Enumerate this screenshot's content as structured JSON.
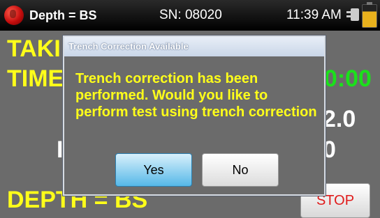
{
  "status_bar": {
    "mode": "Depth = BS",
    "serial": "SN: 08020",
    "time": "11:39 AM",
    "icons": [
      "globe-icon",
      "power-plug-icon",
      "battery-icon"
    ]
  },
  "background_screen": {
    "label_taking": "TAKI",
    "label_time": "TIME",
    "timer_partial": "00:00",
    "value_partial_1": "2.0",
    "value_partial_2": "0",
    "label_partial_m": "I",
    "depth_label": "DEPTH = BS",
    "stop_label": "STOP"
  },
  "dialog": {
    "title": "Trench Correction Available",
    "message": "Trench correction has been performed.  Would you like to perform test using trench correction",
    "yes_label": "Yes",
    "no_label": "No"
  },
  "colors": {
    "accent_yellow": "#ffff1a",
    "timer_green": "#1be11b",
    "stop_red": "#e01b1b",
    "yes_blue": "#56b8e8"
  }
}
